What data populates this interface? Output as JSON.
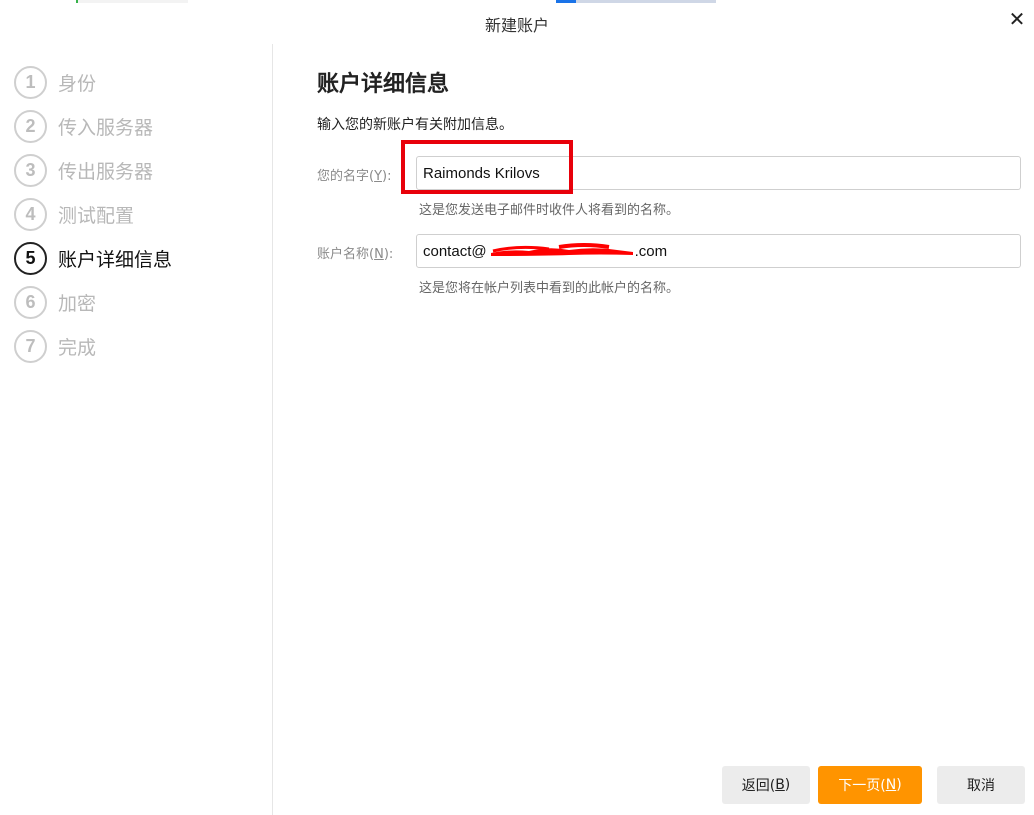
{
  "window": {
    "title": "新建账户"
  },
  "steps": [
    {
      "num": "1",
      "label": "身份"
    },
    {
      "num": "2",
      "label": "传入服务器"
    },
    {
      "num": "3",
      "label": "传出服务器"
    },
    {
      "num": "4",
      "label": "测试配置"
    },
    {
      "num": "5",
      "label": "账户详细信息"
    },
    {
      "num": "6",
      "label": "加密"
    },
    {
      "num": "7",
      "label": "完成"
    }
  ],
  "active_step": 5,
  "main": {
    "heading": "账户详细信息",
    "description": "输入您的新账户有关附加信息。",
    "name_field": {
      "label_prefix": "您的名字(",
      "mnemonic": "Y",
      "label_suffix": "):",
      "value": "Raimonds Krilovs",
      "help": "这是您发送电子邮件时收件人将看到的名称。"
    },
    "account_field": {
      "label_prefix": "账户名称(",
      "mnemonic": "N",
      "label_suffix": "):",
      "value_start": "contact@",
      "value_end": ".com",
      "help": "这是您将在帐户列表中看到的此帐户的名称。"
    }
  },
  "buttons": {
    "back": {
      "text": "返回(",
      "mnemonic": "B",
      "suffix": ")"
    },
    "next": {
      "text": "下一页(",
      "mnemonic": "N",
      "suffix": ")"
    },
    "cancel": {
      "text": "取消"
    }
  },
  "colors": {
    "accent": "#ff9400",
    "highlight": "#e8000a",
    "redaction": "#ff0000"
  }
}
